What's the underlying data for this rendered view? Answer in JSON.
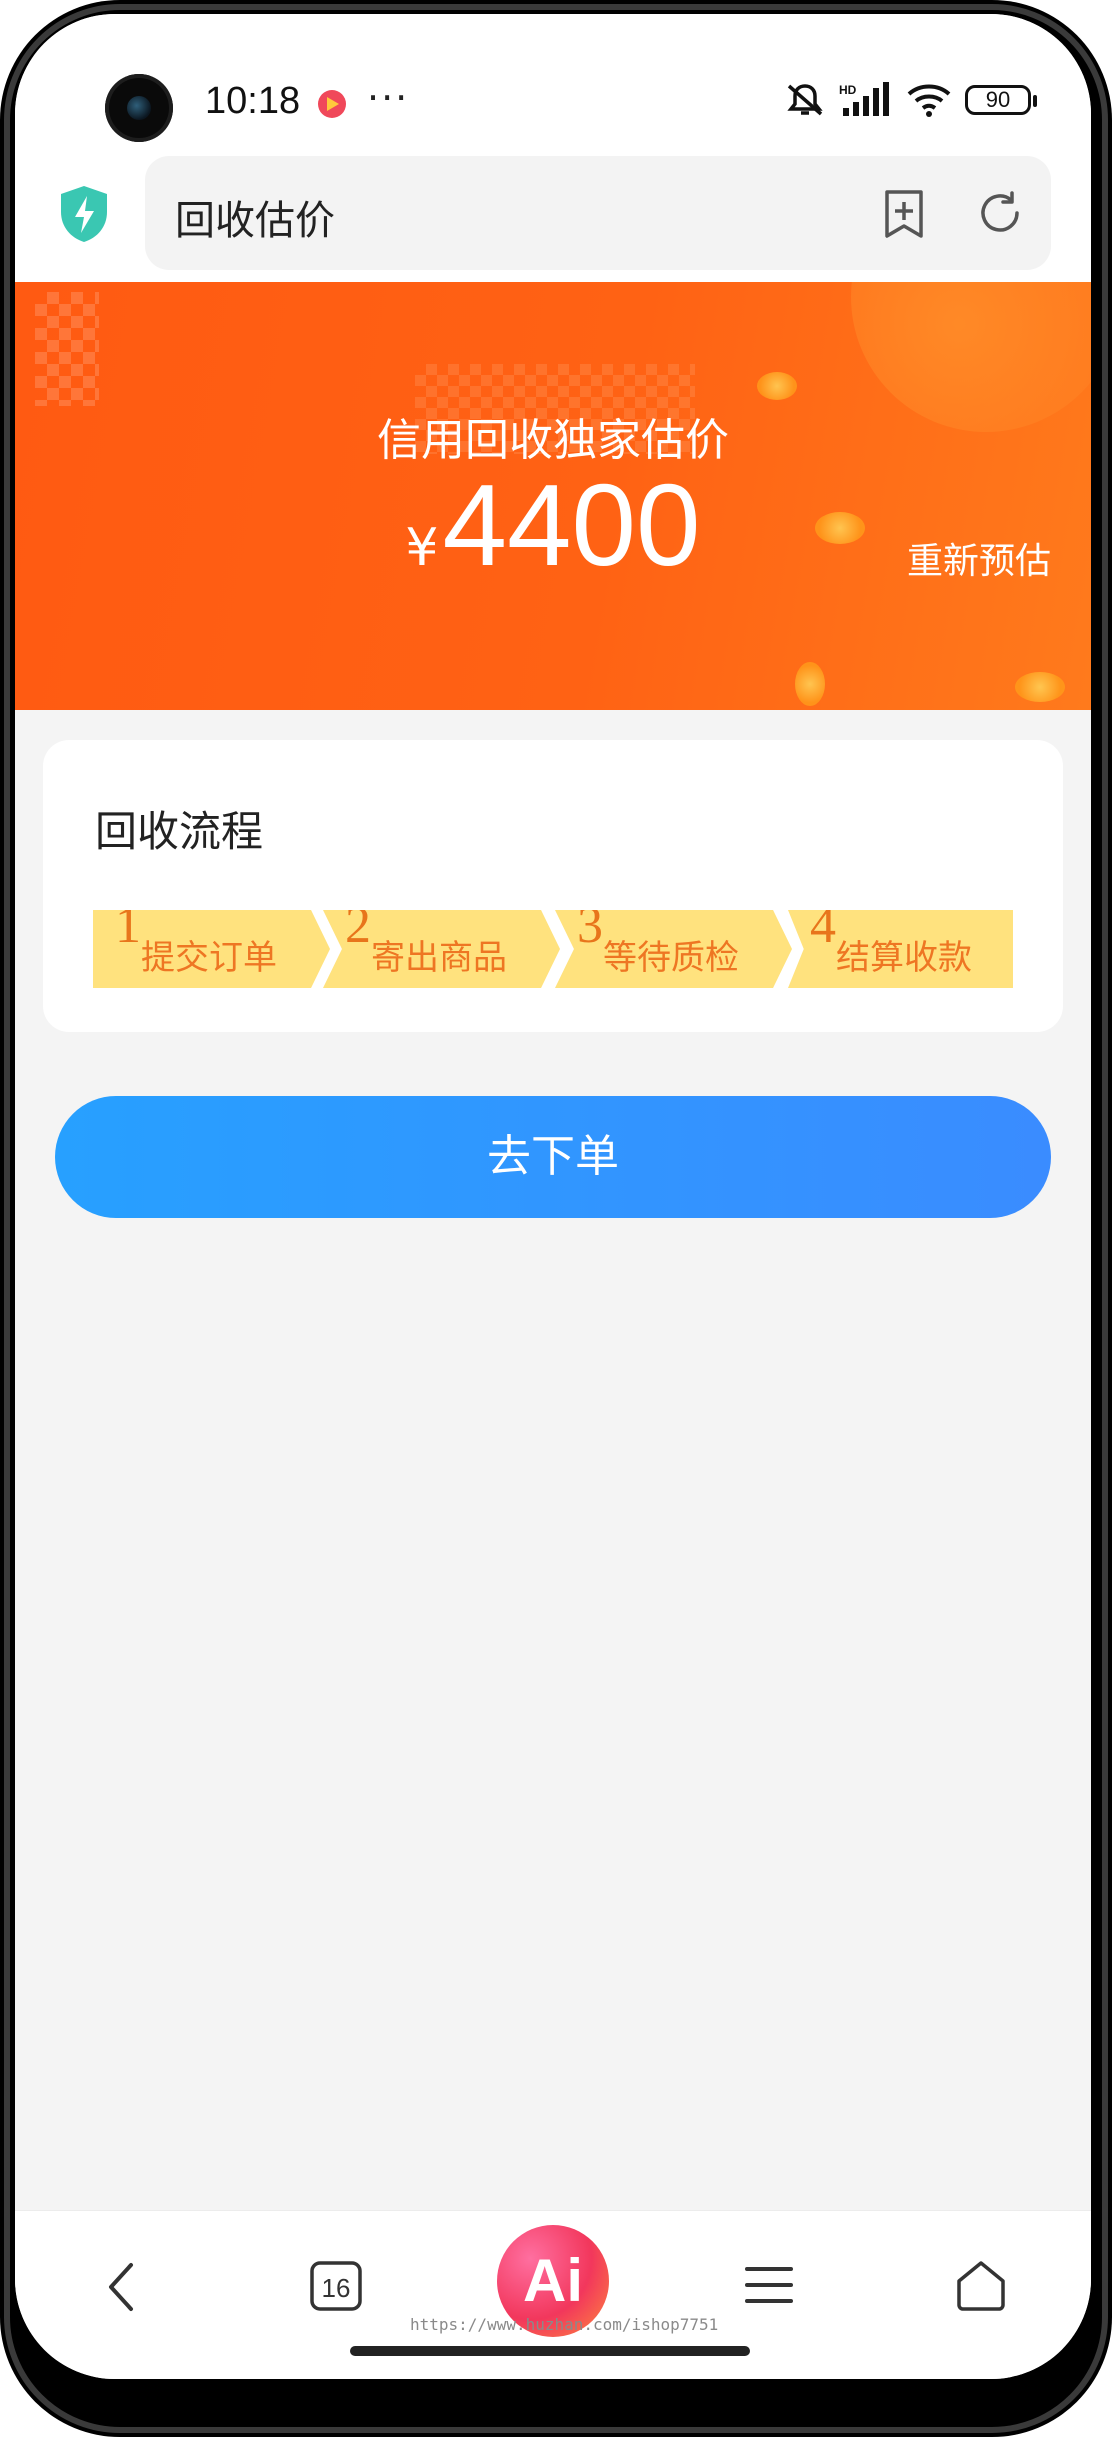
{
  "status_bar": {
    "time": "10:18",
    "more": "···",
    "battery": "90",
    "icons": [
      "mute-icon",
      "hd-signal-icon",
      "wifi-icon",
      "battery-icon"
    ]
  },
  "address_bar": {
    "title": "回收估价",
    "icons": [
      "shield-icon",
      "add-bookmark-icon",
      "refresh-icon"
    ]
  },
  "banner": {
    "title": "信用回收独家估价",
    "currency": "¥",
    "amount": "4400",
    "re_estimate": "重新预估"
  },
  "flow": {
    "title": "回收流程",
    "steps": [
      {
        "num": "1",
        "label": "提交订单"
      },
      {
        "num": "2",
        "label": "寄出商品"
      },
      {
        "num": "3",
        "label": "等待质检"
      },
      {
        "num": "4",
        "label": "结算收款"
      }
    ]
  },
  "order_button": {
    "label": "去下单"
  },
  "bottom_nav": {
    "tabs_count": "16",
    "ai_label": "Ai",
    "watermark": "https://www.huzhan.com/ishop7751",
    "icons": [
      "back-icon",
      "tabs-icon",
      "ai-assistant-icon",
      "menu-icon",
      "home-icon"
    ]
  },
  "colors": {
    "banner_orange": "#ff5e12",
    "button_blue": "#2f96ff",
    "step_yellow": "#ffe27e",
    "step_text_orange": "#ee7623"
  }
}
